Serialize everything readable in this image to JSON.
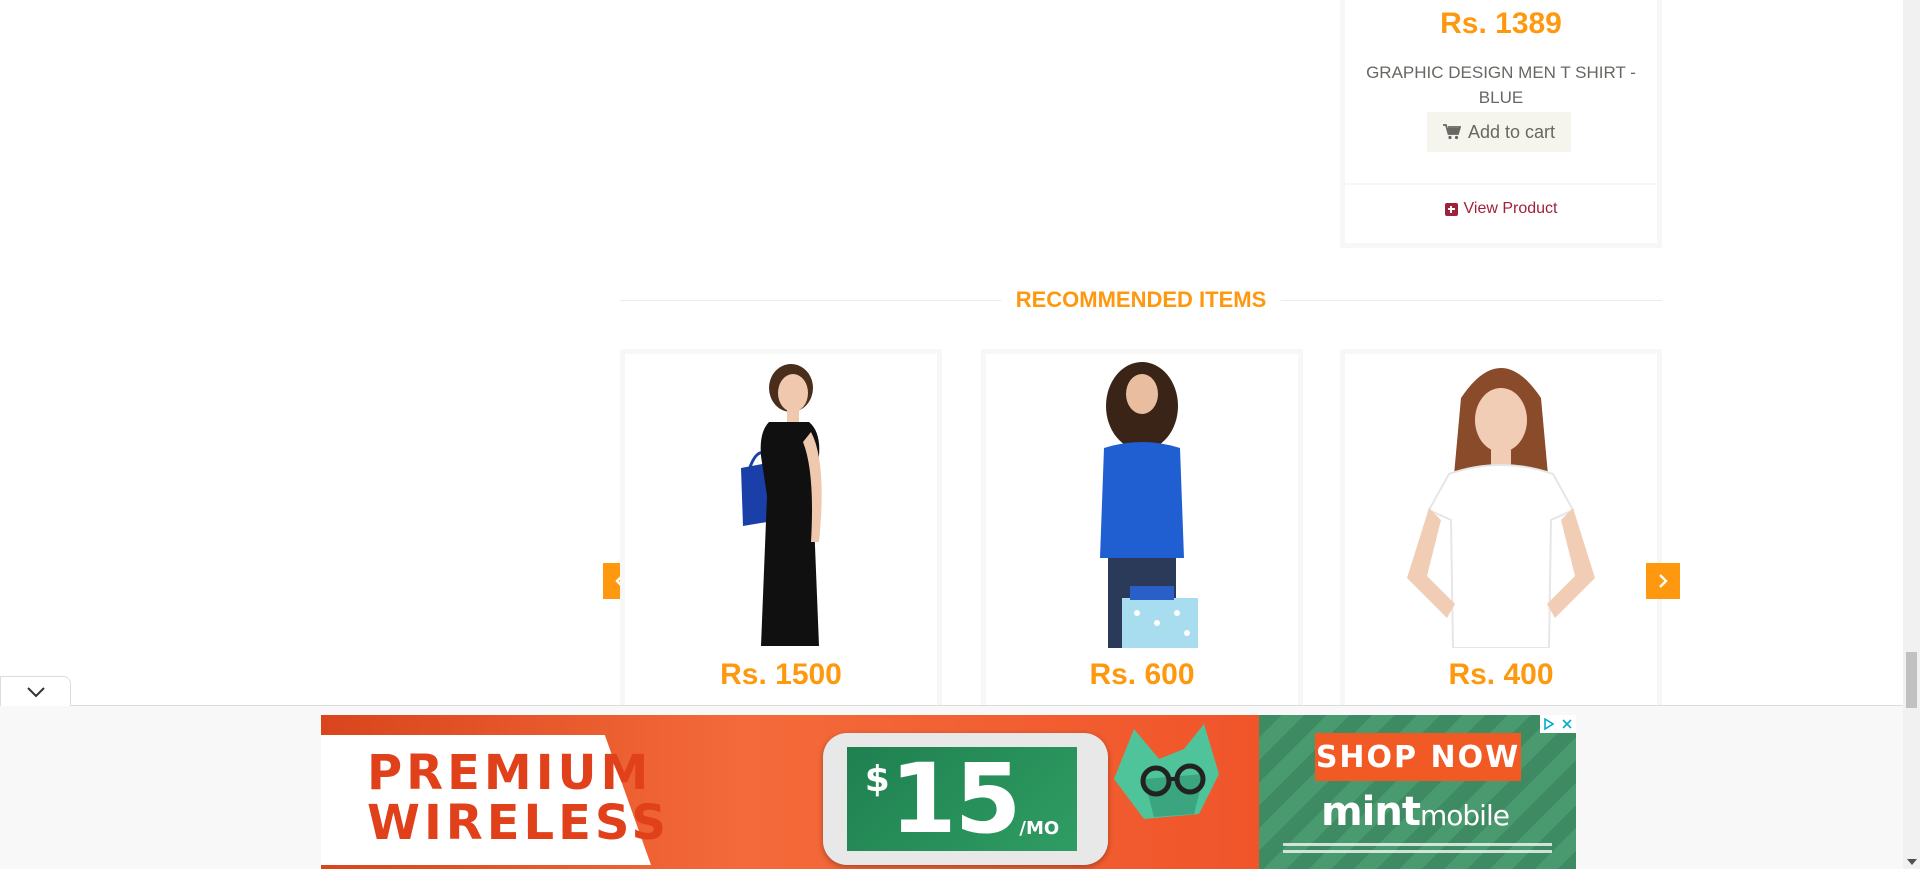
{
  "top_product": {
    "price": "Rs. 1389",
    "name": "GRAPHIC DESIGN MEN T SHIRT - BLUE",
    "add_to_cart_label": "Add to cart",
    "view_product_label": "View Product"
  },
  "recommended": {
    "title": "RECOMMENDED ITEMS",
    "items": [
      {
        "price": "Rs. 1500",
        "image": "woman-black-dress-shopping-bag"
      },
      {
        "price": "Rs. 600",
        "image": "woman-blue-sweater-shopping-bag"
      },
      {
        "price": "Rs. 400",
        "image": "woman-white-tshirt"
      }
    ],
    "prev_icon": "chevron-left-icon",
    "next_icon": "chevron-right-icon"
  },
  "ad": {
    "headline_line1": "PREMIUM",
    "headline_line2": "WIRELESS",
    "price_currency": "$",
    "price_amount": "15",
    "price_period": "/MO",
    "cta": "SHOP NOW",
    "brand_mint": "mint",
    "brand_mobile": "mobile",
    "collapse_icon": "chevron-down-icon",
    "adchoices_icon": "adchoices-icon",
    "close_icon": "close-icon"
  },
  "colors": {
    "accent": "#fe980f",
    "link": "#a0213a",
    "text": "#696763"
  }
}
